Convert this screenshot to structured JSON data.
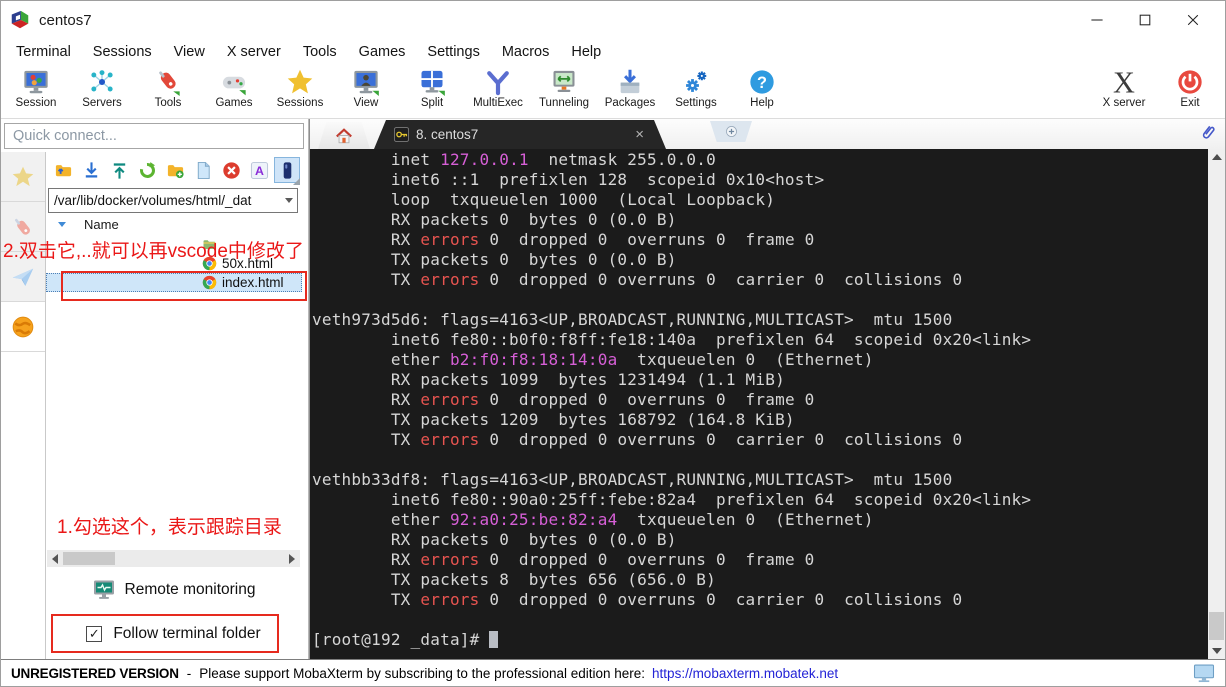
{
  "window": {
    "title": "centos7",
    "app_icon": "mobaxterm-logo-icon"
  },
  "menu": {
    "items": [
      "Terminal",
      "Sessions",
      "View",
      "X server",
      "Tools",
      "Games",
      "Settings",
      "Macros",
      "Help"
    ]
  },
  "toolbar": {
    "items": [
      {
        "label": "Session",
        "icon": "session-icon"
      },
      {
        "label": "Servers",
        "icon": "servers-icon"
      },
      {
        "label": "Tools",
        "icon": "tools-icon"
      },
      {
        "label": "Games",
        "icon": "games-icon"
      },
      {
        "label": "Sessions",
        "icon": "sessions-star-icon"
      },
      {
        "label": "View",
        "icon": "view-icon"
      },
      {
        "label": "Split",
        "icon": "split-icon"
      },
      {
        "label": "MultiExec",
        "icon": "multiexec-icon"
      },
      {
        "label": "Tunneling",
        "icon": "tunneling-icon"
      },
      {
        "label": "Packages",
        "icon": "packages-icon"
      },
      {
        "label": "Settings",
        "icon": "settings-icon"
      },
      {
        "label": "Help",
        "icon": "help-icon"
      }
    ],
    "right_items": [
      {
        "label": "X server",
        "icon": "xserver-icon"
      },
      {
        "label": "Exit",
        "icon": "exit-icon"
      }
    ]
  },
  "sidebar": {
    "quick_connect_placeholder": "Quick connect...",
    "strip": [
      {
        "name": "sessions",
        "icon": "star-faded-icon",
        "active": false
      },
      {
        "name": "tools",
        "icon": "knife-faded-icon",
        "active": false
      },
      {
        "name": "macros",
        "icon": "paper-plane-icon",
        "active": false
      },
      {
        "name": "sftp",
        "icon": "globe-icon",
        "active": true
      }
    ],
    "file_toolbar": [
      {
        "name": "go-up",
        "icon": "folder-up-icon",
        "active": false
      },
      {
        "name": "download",
        "icon": "download-icon",
        "active": false
      },
      {
        "name": "upload",
        "icon": "upload-icon",
        "active": false
      },
      {
        "name": "refresh",
        "icon": "refresh-icon",
        "active": false
      },
      {
        "name": "new-folder",
        "icon": "new-folder-icon",
        "active": false
      },
      {
        "name": "new-file",
        "icon": "new-file-icon",
        "active": false
      },
      {
        "name": "delete",
        "icon": "delete-icon",
        "active": false
      },
      {
        "name": "rename",
        "icon": "rename-icon",
        "active": false
      },
      {
        "name": "follow-folder",
        "icon": "track-icon",
        "active": true
      }
    ],
    "path": "/var/lib/docker/volumes/html/_dat",
    "list_header": "Name",
    "files": [
      {
        "label": "",
        "icon": "folder-icon",
        "selected": false
      },
      {
        "label": "50x.html",
        "icon": "chrome-icon",
        "selected": false
      },
      {
        "label": "index.html",
        "icon": "chrome-icon",
        "selected": true
      }
    ],
    "annotations": {
      "step2": "2.双击它,..就可以再vscode中修改了",
      "step1": "1.勾选这个，表示跟踪目录"
    },
    "remote_monitoring": {
      "label": "Remote monitoring",
      "icon": "remote-monitor-icon"
    },
    "follow": {
      "label": "Follow terminal folder",
      "checked": true,
      "checkmark": "✓"
    }
  },
  "tabs": {
    "home_icon": "home-icon",
    "active": {
      "icon": "key-icon",
      "label": "8. centos7",
      "close": "×"
    },
    "new_tab_icon": "plus-icon",
    "paperclip_icon": "paperclip-icon"
  },
  "terminal": {
    "lines": [
      [
        {
          "t": "        inet "
        },
        {
          "t": "127.0.0.1",
          "c": "magenta"
        },
        {
          "t": "  netmask 255.0.0.0"
        }
      ],
      [
        {
          "t": "        inet6 ::1  prefixlen 128  scopeid 0x10<host>"
        }
      ],
      [
        {
          "t": "        loop  txqueuelen 1000  (Local Loopback)"
        }
      ],
      [
        {
          "t": "        RX packets 0  bytes 0 (0.0 B)"
        }
      ],
      [
        {
          "t": "        RX "
        },
        {
          "t": "errors",
          "c": "red"
        },
        {
          "t": " 0  dropped 0  overruns 0  frame 0"
        }
      ],
      [
        {
          "t": "        TX packets 0  bytes 0 (0.0 B)"
        }
      ],
      [
        {
          "t": "        TX "
        },
        {
          "t": "errors",
          "c": "red"
        },
        {
          "t": " 0  dropped 0 overruns 0  carrier 0  collisions 0"
        }
      ],
      [],
      [
        {
          "t": "veth973d5d6: flags=4163<UP,BROADCAST,RUNNING,MULTICAST>  mtu 1500"
        }
      ],
      [
        {
          "t": "        inet6 fe80::b0f0:f8ff:fe18:140a  prefixlen 64  scopeid 0x20<link>"
        }
      ],
      [
        {
          "t": "        ether "
        },
        {
          "t": "b2:f0:f8:18:14:0a",
          "c": "magenta"
        },
        {
          "t": "  txqueuelen 0  (Ethernet)"
        }
      ],
      [
        {
          "t": "        RX packets 1099  bytes 1231494 (1.1 MiB)"
        }
      ],
      [
        {
          "t": "        RX "
        },
        {
          "t": "errors",
          "c": "red"
        },
        {
          "t": " 0  dropped 0  overruns 0  frame 0"
        }
      ],
      [
        {
          "t": "        TX packets 1209  bytes 168792 (164.8 KiB)"
        }
      ],
      [
        {
          "t": "        TX "
        },
        {
          "t": "errors",
          "c": "red"
        },
        {
          "t": " 0  dropped 0 overruns 0  carrier 0  collisions 0"
        }
      ],
      [],
      [
        {
          "t": "vethbb33df8: flags=4163<UP,BROADCAST,RUNNING,MULTICAST>  mtu 1500"
        }
      ],
      [
        {
          "t": "        inet6 fe80::90a0:25ff:febe:82a4  prefixlen 64  scopeid 0x20<link>"
        }
      ],
      [
        {
          "t": "        ether "
        },
        {
          "t": "92:a0:25:be:82:a4",
          "c": "magenta"
        },
        {
          "t": "  txqueuelen 0  (Ethernet)"
        }
      ],
      [
        {
          "t": "        RX packets 0  bytes 0 (0.0 B)"
        }
      ],
      [
        {
          "t": "        RX "
        },
        {
          "t": "errors",
          "c": "red"
        },
        {
          "t": " 0  dropped 0  overruns 0  frame 0"
        }
      ],
      [
        {
          "t": "        TX packets 8  bytes 656 (656.0 B)"
        }
      ],
      [
        {
          "t": "        TX "
        },
        {
          "t": "errors",
          "c": "red"
        },
        {
          "t": " 0  dropped 0 overruns 0  carrier 0  collisions 0"
        }
      ],
      [],
      [
        {
          "t": "[root@192 _data]# "
        },
        {
          "t": " ",
          "cursor": true
        }
      ]
    ]
  },
  "statusbar": {
    "version_label": "UNREGISTERED VERSION",
    "separator": "-",
    "message": "Please support MobaXterm by subscribing to the professional edition here:",
    "link": "https://mobaxterm.mobatek.net",
    "icon": "monitor-icon"
  },
  "colors": {
    "magenta": "#d75fd7",
    "red": "#e85450",
    "terminal_bg": "#1b1b1b",
    "terminal_fg": "#d6d6d6",
    "annotation_red": "#ea1717",
    "redbox": "#e62a1e",
    "selection_bg": "#cfe6f9",
    "link_blue": "#2323d6"
  }
}
